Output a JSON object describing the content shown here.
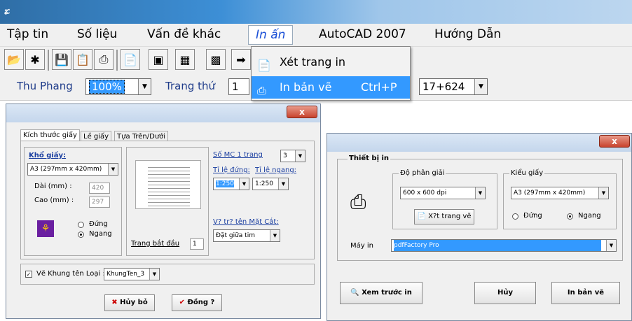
{
  "titlebar": {
    "app_icon": "ፚ"
  },
  "menu": [
    "Tập tin",
    "Số liệu",
    "Vấn đề khác",
    "In ấn",
    "AutoCAD 2007",
    "Hướng Dẫn"
  ],
  "dropdown": {
    "setup_label": "Xét trang in",
    "print_label": "In bản vẽ",
    "print_shortcut": "Ctrl+P"
  },
  "row3": {
    "zoom_label": "Thu Phang",
    "zoom_value": "100%",
    "page_label": "Trang thứ",
    "page_value": "1",
    "station_value": "17+624"
  },
  "paper_dialog": {
    "close": "x",
    "tabs": [
      "Kích thước giấy",
      "Lề giấy",
      "Tựa Trên/Dưới"
    ],
    "size_heading": "Khổ giấy:",
    "size_value": "A3 (297mm x 420mm)",
    "width_label": "Dài (mm) :",
    "width_value": "420",
    "height_label": "Cao (mm) :",
    "height_value": "297",
    "portrait": "Đứng",
    "landscape": "Ngang",
    "start_page_label": "Trang bắt đầu",
    "start_page_value": "1",
    "mc_label": "Số MC 1 trang",
    "mc_value": "3",
    "scale_v_label": "Tỉ lệ đứng:",
    "scale_h_label": "Tỉ lệ ngang:",
    "scale_v_value": "1:250",
    "scale_h_value": "1:250",
    "section_label": "V? tr? tên Mặt Cắt:",
    "section_value": "Đặt giữa tim",
    "frame_label": "Vẽ Khung tên Loại :",
    "frame_value": "KhungTen_3",
    "cancel": "Hủy bỏ",
    "ok": "Đồng ?"
  },
  "print_dialog": {
    "close": "x",
    "group": "Thiết bị in",
    "resolution_label": "Độ phân giải",
    "resolution_value": "600 x 600 dpi",
    "page_btn": "X?t trang vẽ",
    "paper_label": "Kiểu giấy",
    "paper_value": "A3 (297mm x 420mm)",
    "portrait": "Đứng",
    "landscape": "Ngang",
    "printer_label": "Máy in",
    "printer_value": "pdfFactory Pro",
    "preview": "Xem trước in",
    "cancel": "Hủy",
    "print": "In bản vẽ"
  }
}
